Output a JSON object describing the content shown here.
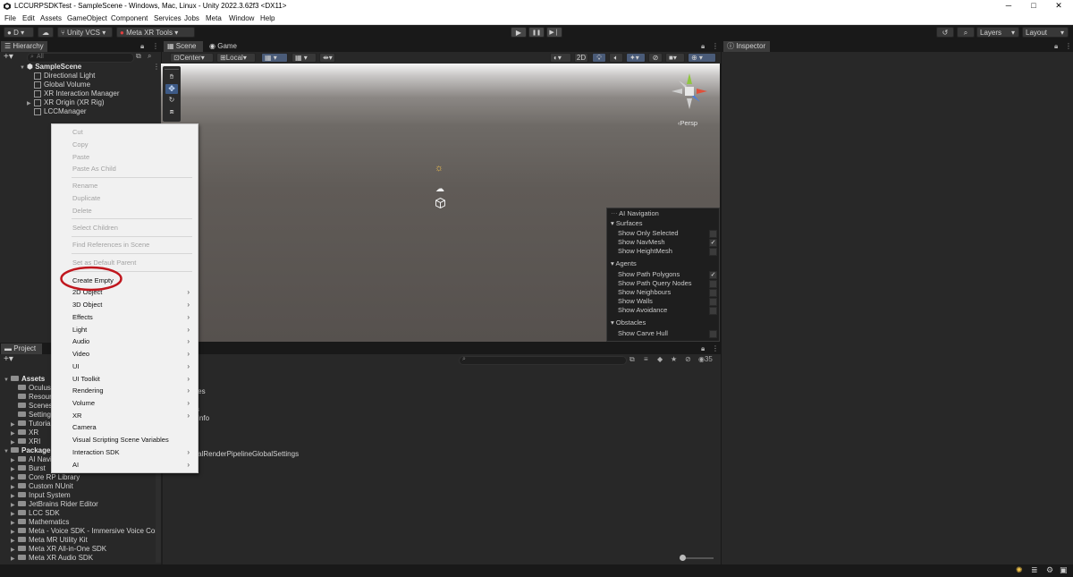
{
  "window": {
    "title": "LCCURPSDKTest - SampleScene - Windows, Mac, Linux - Unity 2022.3.62f3 <DX11>",
    "minimize": "─",
    "maximize": "□",
    "close": "✕"
  },
  "menubar": [
    "File",
    "Edit",
    "Assets",
    "GameObject",
    "Component",
    "Services",
    "Jobs",
    "Meta",
    "Window",
    "Help"
  ],
  "toolbar": {
    "account": "D",
    "version_control": "Unity VCS",
    "meta_tools": "Meta XR Tools",
    "play": "▶",
    "pause": "❚❚",
    "step": "▶❘",
    "layers": "Layers",
    "layout": "Layout"
  },
  "hierarchy": {
    "tab": "Hierarchy",
    "search_placeholder": "All",
    "scene": "SampleScene",
    "items": [
      "Directional Light",
      "Global Volume",
      "XR Interaction Manager",
      "XR Origin (XR Rig)",
      "LCCManager"
    ]
  },
  "scene_tabs": {
    "scene": "Scene",
    "game": "Game"
  },
  "scene_toolbar": {
    "pivot": "Center",
    "space": "Local",
    "mode2d": "2D"
  },
  "scene_gizmo": {
    "projection": "Persp"
  },
  "inspector": {
    "tab": "Inspector"
  },
  "context_menu": {
    "items": [
      {
        "label": "Cut",
        "disabled": true
      },
      {
        "label": "Copy",
        "disabled": true
      },
      {
        "label": "Paste",
        "disabled": true
      },
      {
        "label": "Paste As Child",
        "disabled": true
      },
      {
        "label": "Rename",
        "disabled": true
      },
      {
        "label": "Duplicate",
        "disabled": true
      },
      {
        "label": "Delete",
        "disabled": true
      },
      {
        "label": "Select Children",
        "disabled": true
      },
      {
        "label": "Find References in Scene",
        "disabled": true
      },
      {
        "label": "Set as Default Parent",
        "disabled": true
      },
      {
        "label": "Create Empty",
        "disabled": false
      },
      {
        "label": "2D Object",
        "disabled": false
      },
      {
        "label": "3D Object",
        "disabled": false
      },
      {
        "label": "Effects",
        "disabled": false
      },
      {
        "label": "Light",
        "disabled": false
      },
      {
        "label": "Audio",
        "disabled": false
      },
      {
        "label": "Video",
        "disabled": false
      },
      {
        "label": "UI",
        "disabled": false
      },
      {
        "label": "UI Toolkit",
        "disabled": false
      },
      {
        "label": "Rendering",
        "disabled": false
      },
      {
        "label": "Volume",
        "disabled": false
      },
      {
        "label": "XR",
        "disabled": false
      },
      {
        "label": "Camera",
        "disabled": false
      },
      {
        "label": "Visual Scripting Scene Variables",
        "disabled": false
      },
      {
        "label": "Interaction SDK",
        "disabled": false
      },
      {
        "label": "AI",
        "disabled": false
      }
    ],
    "submenu_arrow": "›",
    "highlight_color": "#c0171e"
  },
  "ai_navigation": {
    "title": "AI Navigation",
    "surfaces_label": "Surfaces",
    "surfaces": [
      {
        "label": "Show Only Selected",
        "checked": false
      },
      {
        "label": "Show NavMesh",
        "checked": true
      },
      {
        "label": "Show HeightMesh",
        "checked": false
      }
    ],
    "agents_label": "Agents",
    "agents": [
      {
        "label": "Show Path Polygons",
        "checked": true
      },
      {
        "label": "Show Path Query Nodes",
        "checked": false
      },
      {
        "label": "Show Neighbours",
        "checked": false
      },
      {
        "label": "Show Walls",
        "checked": false
      },
      {
        "label": "Show Avoidance",
        "checked": false
      }
    ],
    "obstacles_label": "Obstacles",
    "obstacles": [
      {
        "label": "Show Carve Hull",
        "checked": false
      }
    ],
    "check_mark": "✓"
  },
  "project": {
    "tab": "Project",
    "hidden_count": "35",
    "assets_root": "Assets",
    "assets": [
      "Oculus",
      "Resour",
      "Scenes",
      "Settings",
      "Tutorial",
      "XR",
      "XRI"
    ],
    "packages_root": "Packages",
    "packages": [
      "AI Navig",
      "Burst",
      "Core RP Library",
      "Custom NUnit",
      "Input System",
      "JetBrains Rider Editor",
      "LCC SDK",
      "Mathematics",
      "Meta - Voice SDK - Immersive Voice Cor",
      "Meta MR Utility Kit",
      "Meta XR All-in-One SDK",
      "Meta XR Audio SDK"
    ],
    "right_list": [
      "us",
      "urces",
      "es",
      "ngs",
      "rialInfo",
      "",
      "",
      "me",
      "ersalRenderPipelineGlobalSettings"
    ]
  }
}
